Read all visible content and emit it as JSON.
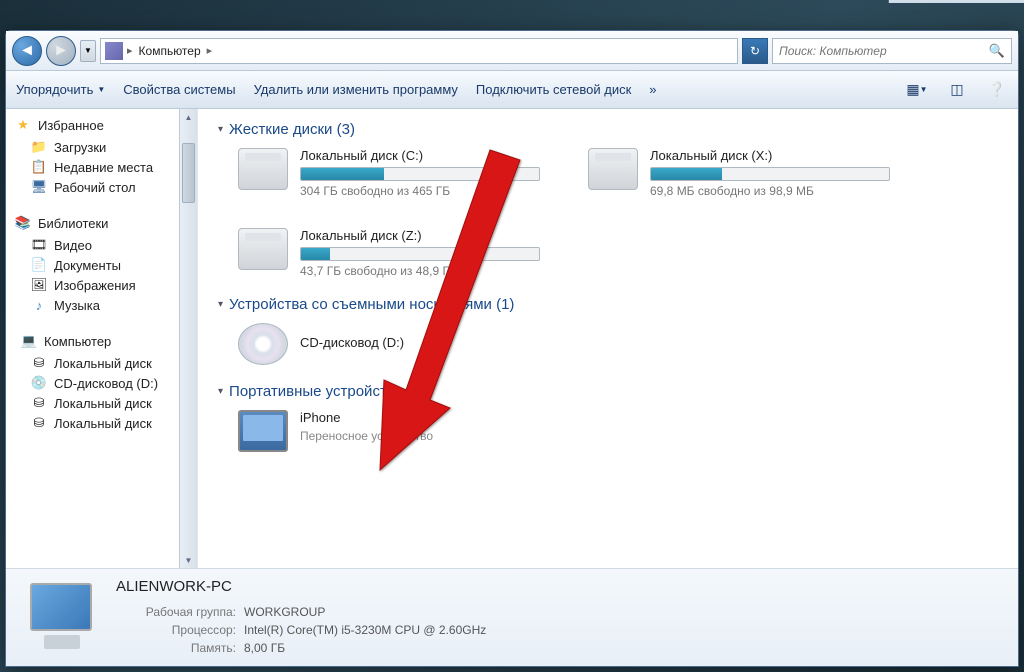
{
  "address": {
    "location": "Компьютер"
  },
  "search": {
    "placeholder": "Поиск: Компьютер"
  },
  "toolbar": {
    "organize": "Упорядочить",
    "sysprops": "Свойства системы",
    "uninstall": "Удалить или изменить программу",
    "mapdrive": "Подключить сетевой диск"
  },
  "sidebar": {
    "favorites": {
      "label": "Избранное",
      "downloads": "Загрузки",
      "recent": "Недавние места",
      "desktop": "Рабочий стол"
    },
    "libraries": {
      "label": "Библиотеки",
      "video": "Видео",
      "docs": "Документы",
      "images": "Изображения",
      "music": "Музыка"
    },
    "computer": {
      "label": "Компьютер",
      "d1": "Локальный диск",
      "d2": "CD-дисковод (D:)",
      "d3": "Локальный диск",
      "d4": "Локальный диск"
    }
  },
  "sections": {
    "hdd": {
      "title": "Жесткие диски (3)"
    },
    "removable": {
      "title": "Устройства со съемными носителями (1)"
    },
    "portable": {
      "title": "Портативные устройства (1)"
    }
  },
  "drives": {
    "c": {
      "name": "Локальный диск (C:)",
      "free": "304 ГБ свободно из 465 ГБ",
      "fill": 35
    },
    "x": {
      "name": "Локальный диск (X:)",
      "free": "69,8 МБ свободно из 98,9 МБ",
      "fill": 30
    },
    "z": {
      "name": "Локальный диск (Z:)",
      "free": "43,7 ГБ свободно из 48,9 ГБ",
      "fill": 12
    },
    "d": {
      "name": "CD-дисковод (D:)"
    },
    "iphone": {
      "name": "iPhone",
      "sub": "Переносное устройство"
    }
  },
  "details": {
    "pcname": "ALIENWORK-PC",
    "workgroup_lbl": "Рабочая группа:",
    "workgroup": "WORKGROUP",
    "cpu_lbl": "Процессор:",
    "cpu": "Intel(R) Core(TM) i5-3230M CPU @ 2.60GHz",
    "ram_lbl": "Память:",
    "ram": "8,00 ГБ"
  }
}
